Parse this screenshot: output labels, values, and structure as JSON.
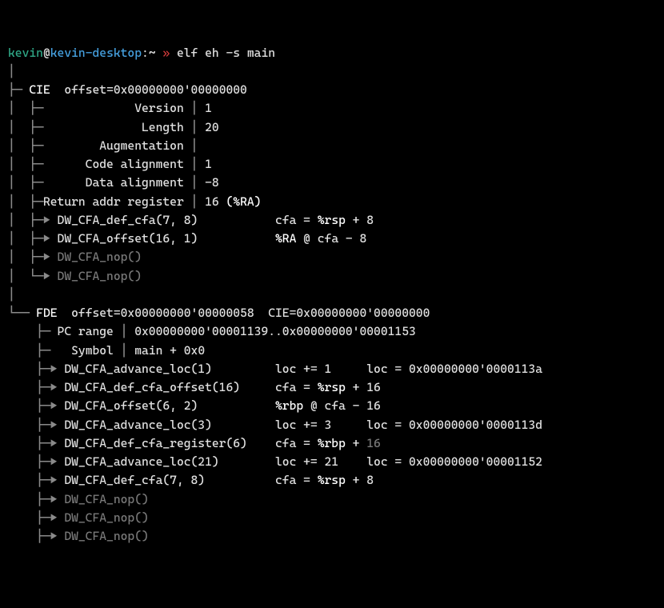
{
  "prompt": {
    "user": "kevin",
    "at": "@",
    "host": "kevin-desktop",
    "colon": ":",
    "path": "~",
    "sep": " »",
    "cmd": " elf eh -s main"
  },
  "cie": {
    "title": "CIE",
    "offset": "offset=0x00000000'00000000",
    "fields": {
      "version_lbl": "            Version",
      "version_val": "1",
      "length_lbl": "             Length",
      "length_val": "20",
      "aug_lbl": "       Augmentation",
      "aug_val": "",
      "code_lbl": "     Code alignment",
      "code_val": "1",
      "data_lbl": "     Data alignment",
      "data_val": "-8",
      "ret_lbl": "Return addr register",
      "ret_val": "16 ",
      "ret_reg": "(%RA)"
    },
    "ops": [
      {
        "name": "DW_CFA_def_cfa(7, 8)",
        "ann": "cfa = ",
        "reg": "%rsp",
        "rest": " + 8",
        "dim": false
      },
      {
        "name": "DW_CFA_offset(16, 1)",
        "ann": "",
        "reg": "%RA",
        "rest": " @ cfa - 8",
        "dim": false
      },
      {
        "name": "DW_CFA_nop()",
        "dim": true
      },
      {
        "name": "DW_CFA_nop()",
        "dim": true
      }
    ]
  },
  "fde": {
    "title": "FDE",
    "offset": "offset=0x00000000'00000058",
    "cieref": "CIE=0x00000000'00000000",
    "pcrange_lbl": "PC range",
    "pcrange_val": "0x00000000'00001139..0x00000000'00001153",
    "symbol_lbl": "  Symbol",
    "symbol_val": "main + 0x0",
    "ops": [
      {
        "name": "DW_CFA_advance_loc(1)",
        "col2": "loc += 1",
        "col3": "loc = 0x00000000'0000113a"
      },
      {
        "name": "DW_CFA_def_cfa_offset(16)",
        "col2r": "cfa = ",
        "reg": "%rsp",
        "after": " + 16"
      },
      {
        "name": "DW_CFA_offset(6, 2)",
        "col2r": "",
        "reg": "%rbp",
        "after": " @ cfa - 16"
      },
      {
        "name": "DW_CFA_advance_loc(3)",
        "col2": "loc += 3",
        "col3": "loc = 0x00000000'0000113d"
      },
      {
        "name": "DW_CFA_def_cfa_register(6)",
        "col2r": "cfa = ",
        "reg": "%rbp",
        "after": " + ",
        "dimtail": "16"
      },
      {
        "name": "DW_CFA_advance_loc(21)",
        "col2": "loc += 21",
        "col3": "loc = 0x00000000'00001152"
      },
      {
        "name": "DW_CFA_def_cfa(7, 8)",
        "col2r": "cfa = ",
        "reg": "%rsp",
        "after": " + 8"
      },
      {
        "name": "DW_CFA_nop()",
        "dim": true
      },
      {
        "name": "DW_CFA_nop()",
        "dim": true
      },
      {
        "name": "DW_CFA_nop()",
        "dim": true
      }
    ]
  }
}
